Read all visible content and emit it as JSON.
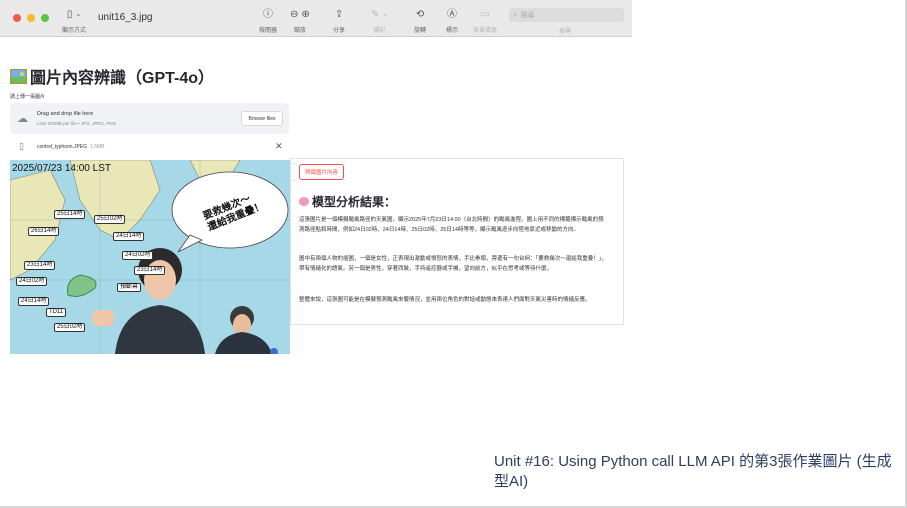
{
  "window": {
    "title": "unit16_3.jpg",
    "view_label": "顯示方式",
    "toolbar": [
      {
        "label": "檢閱器",
        "icon": "info-icon"
      },
      {
        "label": "縮放",
        "icon": "zoom-icons"
      },
      {
        "label": "分享",
        "icon": "share-icon"
      },
      {
        "label": "標記",
        "icon": "markup-icon"
      },
      {
        "label": "旋轉",
        "icon": "rotate-icon"
      },
      {
        "label": "標示",
        "icon": "highlight-icon"
      },
      {
        "label": "表單填寫",
        "icon": "form-icon"
      }
    ],
    "search_placeholder": "搜尋",
    "search_label": "搜尋"
  },
  "app": {
    "title": "圖片內容辨識（GPT-4o）",
    "upload_label": "請上傳一張圖片",
    "dropzone": {
      "text": "Drag and drop file here",
      "limit": "Limit 200MB per file • JPG, JPEG, PNG",
      "browse_button": "Browse files"
    },
    "file": {
      "name": "control_typhoon.JPEG",
      "size": "1.5MB"
    }
  },
  "image": {
    "timestamp": "2025/07/23 14:00 LST",
    "bubble_line1": "要救幾次～",
    "bubble_line2": "還給我重疊！",
    "map_labels": [
      "25日14時",
      "25日02時",
      "26日14時",
      "24日14時",
      "24日02時",
      "23日14時",
      "23日14時",
      "24日02時",
      "24日14時",
      "預斷幕",
      "TD11",
      "25日02時"
    ]
  },
  "result": {
    "button": "辨識圖片內容",
    "heading": "模型分析結果：",
    "paragraphs": [
      "這張圖片是一個模擬颱風路徑的天氣圖，顯示2025年7月23日14:00（台北時間）的颱風進程。圖上用不同的標籤標示颱風的預測路徑點和時間，例如24日02時、24日14時、25日02時、25日14時等等，顯示颱風逐步向陸地靠近或移動的方向。",
      "圖中有兩個人物的插圖，一個是女性，正表現出激動或憤怒的表情，手比拳頭，旁邊有一句台詞：「要救幾次～還給我重疊！」，帶有情緒化的語氣。另一個是男性，穿著西裝，手持遙控器或手機，望向前方，似乎在思考或等待什麼。",
      "整體來說，這張圖可能是在模擬預測颱風來襲情況，並用兩位角色的對話或動態來表達人們面對天氣災害時的情緒反應。"
    ]
  },
  "caption": "Unit #16: Using Python call LLM API 的第3張作業圖片 (生成型AI)"
}
